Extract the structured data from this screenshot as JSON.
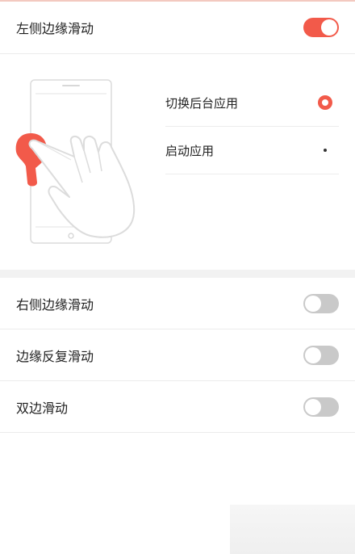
{
  "left_edge": {
    "label": "左侧边缘滑动",
    "enabled": true
  },
  "left_edge_options": [
    {
      "label": "切换后台应用",
      "selected": true
    },
    {
      "label": "启动应用",
      "selected": false
    }
  ],
  "other_settings": [
    {
      "label": "右侧边缘滑动",
      "enabled": false
    },
    {
      "label": "边缘反复滑动",
      "enabled": false
    },
    {
      "label": "双边滑动",
      "enabled": false
    }
  ],
  "colors": {
    "accent": "#f25a4a",
    "toggle_off": "#c9c9c9",
    "divider": "#ececec"
  },
  "icons": {
    "illustration": "phone-edge-swipe-hand-illustration"
  }
}
